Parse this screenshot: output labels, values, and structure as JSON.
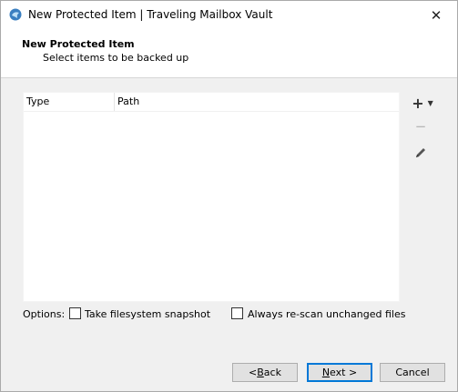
{
  "window": {
    "title": "New Protected Item | Traveling Mailbox Vault",
    "close_glyph": "✕"
  },
  "header": {
    "title": "New Protected Item",
    "subtitle": "Select items to be backed up"
  },
  "table": {
    "columns": [
      "Type",
      "Path"
    ],
    "rows": []
  },
  "toolbar": {
    "add_glyph": "+",
    "add_caret": "▼",
    "remove_glyph": "−"
  },
  "options": {
    "label": "Options:",
    "take_snapshot": {
      "label": "Take filesystem snapshot",
      "checked": false
    },
    "rescan": {
      "label": "Always re-scan unchanged files",
      "checked": false
    }
  },
  "buttons": {
    "back_prefix": "< ",
    "back_accel": "B",
    "back_rest": "ack",
    "next_accel": "N",
    "next_rest": "ext >",
    "cancel": "Cancel"
  },
  "colors": {
    "accent": "#0078d7",
    "app_icon": "#3a7fc1"
  }
}
